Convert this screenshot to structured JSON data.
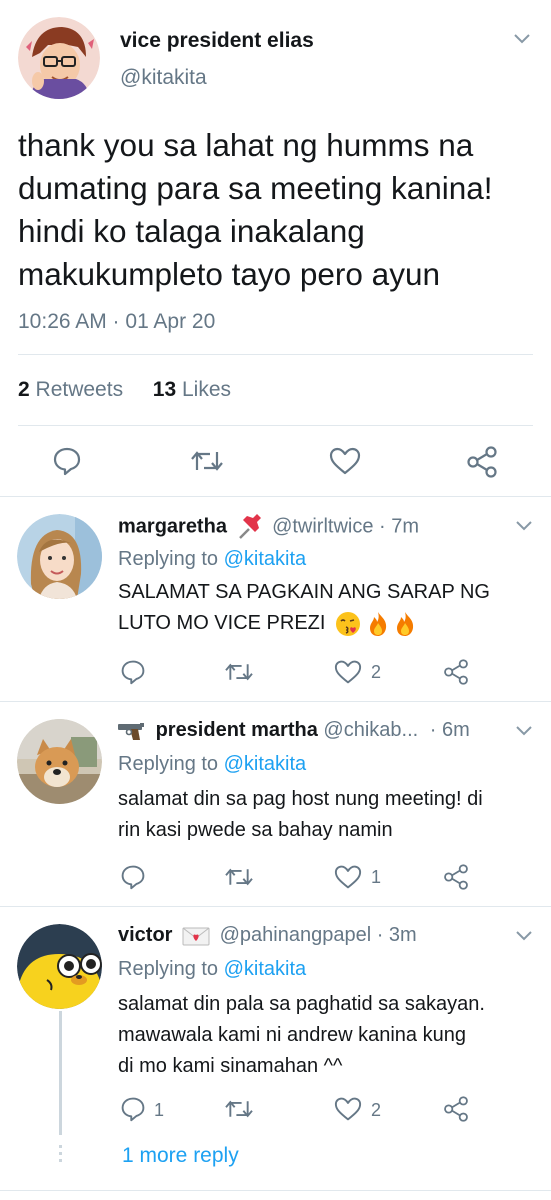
{
  "main_tweet": {
    "display_name": "vice president elias",
    "handle": "@kitakita",
    "text_lines": [
      "thank you sa lahat ng humms na",
      "dumating para sa meeting kanina!",
      "hindi ko talaga inakalang",
      "makukumpleto tayo pero ayun"
    ],
    "timestamp": "10:26 AM · 01 Apr 20",
    "retweets_count": "2",
    "retweets_label": "Retweets",
    "likes_count": "13",
    "likes_label": "Likes",
    "actions": [
      "reply-icon",
      "retweet-icon",
      "like-icon",
      "share-icon"
    ]
  },
  "replies": [
    {
      "display_name": "margaretha",
      "name_emoji": "pushpin-icon",
      "handle": "@twirltwice",
      "time": "· 7m",
      "replying_prefix": "Replying to",
      "replying_to": "@kitakita",
      "text_lines": [
        "SALAMAT SA PAGKAIN ANG SARAP NG",
        "LUTO MO VICE PREZI"
      ],
      "emojis": [
        "kiss-face-icon",
        "fire-icon",
        "fire-icon"
      ],
      "reply_count": "",
      "retweet_count": "",
      "like_count": "2"
    },
    {
      "display_name": "president martha",
      "name_emoji": "pistol-icon",
      "handle": "@chikab...",
      "time": "· 6m",
      "replying_prefix": "Replying to",
      "replying_to": "@kitakita",
      "text_lines": [
        "salamat din sa pag host nung meeting! di",
        "rin kasi pwede sa bahay namin"
      ],
      "reply_count": "",
      "retweet_count": "",
      "like_count": "1"
    },
    {
      "display_name": "victor",
      "name_emoji": "love-letter-icon",
      "handle": "@pahinangpapel",
      "time": "· 3m",
      "replying_prefix": "Replying to",
      "replying_to": "@kitakita",
      "text_lines": [
        "salamat din pala sa paghatid sa sakayan.",
        "mawawala kami ni andrew kanina kung",
        "di mo kami sinamahan ^^"
      ],
      "reply_count": "1",
      "retweet_count": "",
      "like_count": "2"
    }
  ],
  "more_replies_label": "1 more reply",
  "colors": {
    "accent": "#1da1f2",
    "text": "#14171a",
    "secondary": "#657786",
    "divider": "#e1e8ed"
  }
}
